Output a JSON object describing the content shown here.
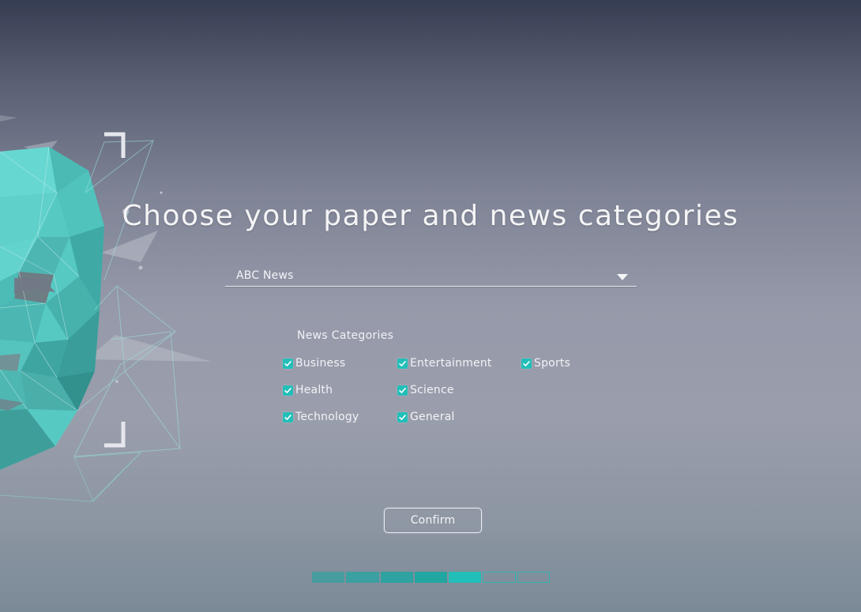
{
  "title": "Choose your paper and news categories",
  "paper_select": {
    "value": "ABC News"
  },
  "categories": {
    "heading": "News Categories",
    "items": [
      {
        "label": "Business",
        "checked": true
      },
      {
        "label": "Entertainment",
        "checked": true
      },
      {
        "label": "Sports",
        "checked": true
      },
      {
        "label": "Health",
        "checked": true
      },
      {
        "label": "Science",
        "checked": true
      },
      {
        "label": "Technology",
        "checked": true
      },
      {
        "label": "General",
        "checked": true
      }
    ]
  },
  "confirm_button": {
    "label": "Confirm"
  },
  "progress": {
    "completed_steps": 5,
    "total_steps": 7
  },
  "colors": {
    "accent": "#22bfb8",
    "accent_dark": "#16a8a2",
    "face_teal": "#57c9c3"
  },
  "icons": {
    "dropdown": "chevron-down-icon",
    "check": "check-icon"
  }
}
